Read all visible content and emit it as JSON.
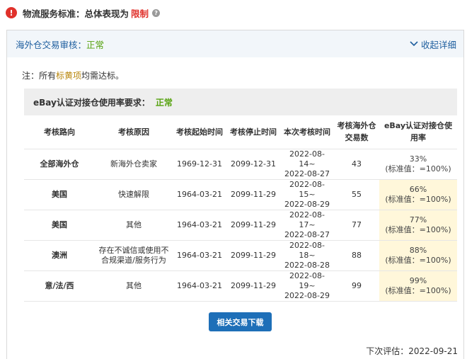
{
  "header": {
    "alert_icon": "exclamation-icon",
    "title": "物流服务标准：总体表现为",
    "status": "限制",
    "status_color": "#e0312b",
    "help_icon": "question-icon"
  },
  "panel": {
    "title": "海外仓交易审核：",
    "title_status": "正常",
    "toggle_label": "收起详细",
    "toggle_icon": "chevron-down-icon"
  },
  "note": {
    "prefix": "注：所有",
    "highlight": "标黄项",
    "suffix": "均需达标。"
  },
  "requirement": {
    "label": "eBay认证对接仓使用率要求：",
    "status": "正常"
  },
  "table": {
    "columns": [
      "考核路向",
      "考核原因",
      "考核起始时间",
      "考核停止时间",
      "本次考核时间",
      "考核海外仓交易数",
      "eBay认证对接仓使用率"
    ],
    "rows": [
      {
        "route": "全部海外仓",
        "reason": "新海外仓卖家",
        "start": "1969-12-31",
        "stop": "2099-12-31",
        "period_start": "2022-08-14~",
        "period_end": "2022-08-27",
        "count": "43",
        "rate": "33%",
        "standard": "(标准值：=100%)",
        "highlighted": false
      },
      {
        "route": "美国",
        "reason": "快速解限",
        "start": "1964-03-21",
        "stop": "2099-11-29",
        "period_start": "2022-08-15~",
        "period_end": "2022-08-29",
        "count": "55",
        "rate": "66%",
        "standard": "(标准值：=100%)",
        "highlighted": true
      },
      {
        "route": "美国",
        "reason": "其他",
        "start": "1964-03-21",
        "stop": "2099-11-29",
        "period_start": "2022-08-17~",
        "period_end": "2022-08-27",
        "count": "77",
        "rate": "77%",
        "standard": "(标准值：=100%)",
        "highlighted": true
      },
      {
        "route": "澳洲",
        "reason": "存在不诚信或使用不合规渠道/服务行为",
        "start": "1964-03-21",
        "stop": "2099-11-29",
        "period_start": "2022-08-18~",
        "period_end": "2022-08-28",
        "count": "88",
        "rate": "88%",
        "standard": "(标准值：=100%)",
        "highlighted": true
      },
      {
        "route": "意/法/西",
        "reason": "其他",
        "start": "1964-03-21",
        "stop": "2099-11-29",
        "period_start": "2022-08-19~",
        "period_end": "2022-08-29",
        "count": "99",
        "rate": "99%",
        "standard": "(标准值：=100%)",
        "highlighted": true
      }
    ]
  },
  "download_button": "相关交易下载",
  "footer": {
    "next_eval": "下次评估：2022-09-21"
  },
  "colors": {
    "ok_green": "#56a20f",
    "link_blue": "#1f5f9f",
    "button_blue": "#1e6fb8",
    "highlight_yellow": "#fff7da"
  }
}
